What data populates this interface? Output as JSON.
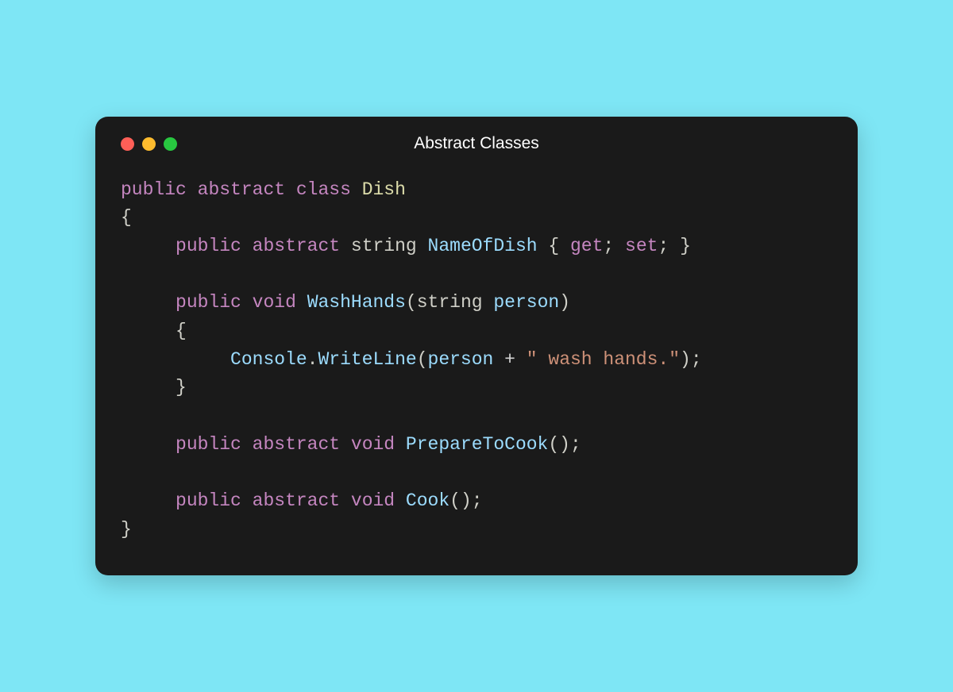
{
  "window": {
    "title": "Abstract Classes"
  },
  "code": {
    "line1": {
      "kw1": "public",
      "kw2": "abstract",
      "kw3": "class",
      "type": "Dish"
    },
    "line2": "{",
    "line3": {
      "indent": "     ",
      "kw1": "public",
      "kw2": "abstract",
      "type": "string",
      "name": "NameOfDish",
      "lbrace": "{",
      "get": "get",
      "set": "set",
      "rbrace": "}"
    },
    "line5": {
      "indent": "     ",
      "kw1": "public",
      "kw2": "void",
      "name": "WashHands",
      "lparen": "(",
      "ptype": "string",
      "pname": "person",
      "rparen": ")"
    },
    "line6": {
      "indent": "     ",
      "text": "{"
    },
    "line7": {
      "indent": "          ",
      "console": "Console",
      "dot": ".",
      "method": "WriteLine",
      "lparen": "(",
      "arg": "person",
      "plus": "+",
      "str": "\" wash hands.\"",
      "rparen": ")",
      "semi": ";"
    },
    "line8": {
      "indent": "     ",
      "text": "}"
    },
    "line10": {
      "indent": "     ",
      "kw1": "public",
      "kw2": "abstract",
      "kw3": "void",
      "name": "PrepareToCook",
      "parens": "();"
    },
    "line12": {
      "indent": "     ",
      "kw1": "public",
      "kw2": "abstract",
      "kw3": "void",
      "name": "Cook",
      "parens": "();"
    },
    "line13": "}"
  }
}
